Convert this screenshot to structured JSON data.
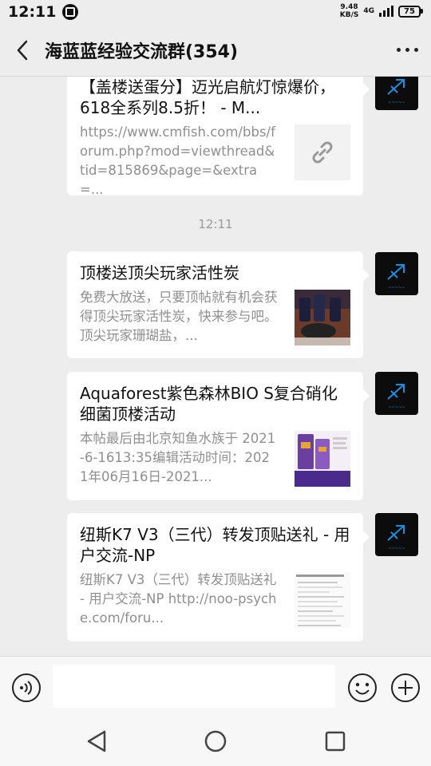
{
  "status": {
    "time": "12:11",
    "net_speed_value": "9.48",
    "net_speed_unit": "KB/S",
    "net_type": "4G",
    "battery": "75"
  },
  "header": {
    "title": "海蓝蓝经验交流群(354)"
  },
  "messages": [
    {
      "title": "【盖楼送蛋分】迈光启航灯惊爆价，618全系列8.5折！ - M...",
      "desc": "https://www.cmfish.com/bbs/forum.php?mod=viewthread&tid=815869&page=&extra=...",
      "thumb_icon": "link-icon"
    },
    {
      "title": "顶楼送顶尖玩家活性炭",
      "desc": "免费大放送，只要顶帖就有机会获得顶尖玩家活性炭，快来参与吧。顶尖玩家珊瑚盐，...",
      "thumb_icon": "activated-carbon-product-image"
    },
    {
      "title": "Aquaforest紫色森林BIO S复合硝化细菌顶楼活动",
      "desc": "本帖最后由北京知鱼水族于 2021-6-1613:35编辑活动时间：2021年06月16日-2021...",
      "thumb_icon": "aquaforest-product-image"
    },
    {
      "title": "纽斯K7 V3（三代）转发顶贴送礼 - 用户交流-NP",
      "desc": "纽斯K7 V3（三代）转发顶贴送礼 - 用户交流-NP http://noo-psyche.com/foru...",
      "thumb_icon": "webpage-screenshot-image"
    }
  ],
  "timestamp": "12:11",
  "input": {
    "value": ""
  },
  "colors": {
    "background": "#ededed",
    "bubble": "#ffffff",
    "avatar": "#0c0c0c",
    "avatar_accent": "#1a8fe0"
  }
}
